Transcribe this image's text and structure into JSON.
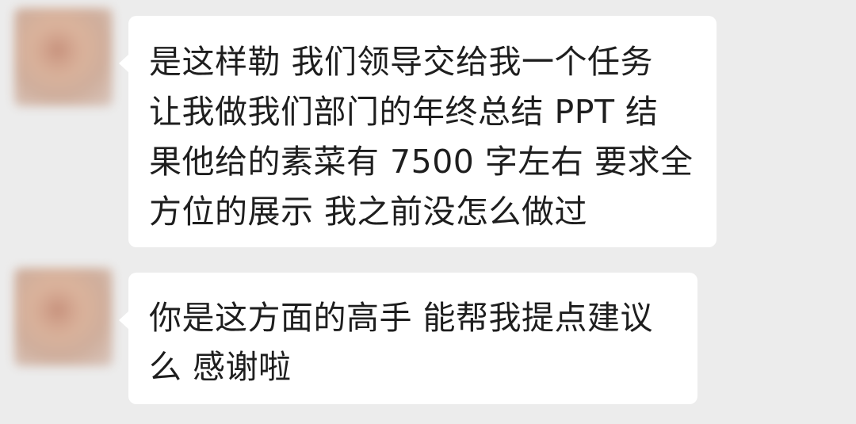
{
  "messages": [
    {
      "lines": [
        "是这样勒 我们领导交给我一个任务",
        "让我做我们部门的年终总结 PPT 结",
        "果他给的素菜有 7500 字左右 要求全",
        "方位的展示 我之前没怎么做过"
      ]
    },
    {
      "lines": [
        "你是这方面的高手 能帮我提点建议",
        "么 感谢啦"
      ]
    }
  ],
  "colors": {
    "background": "#ececec",
    "bubble": "#ffffff",
    "text": "#1e1e1e"
  }
}
